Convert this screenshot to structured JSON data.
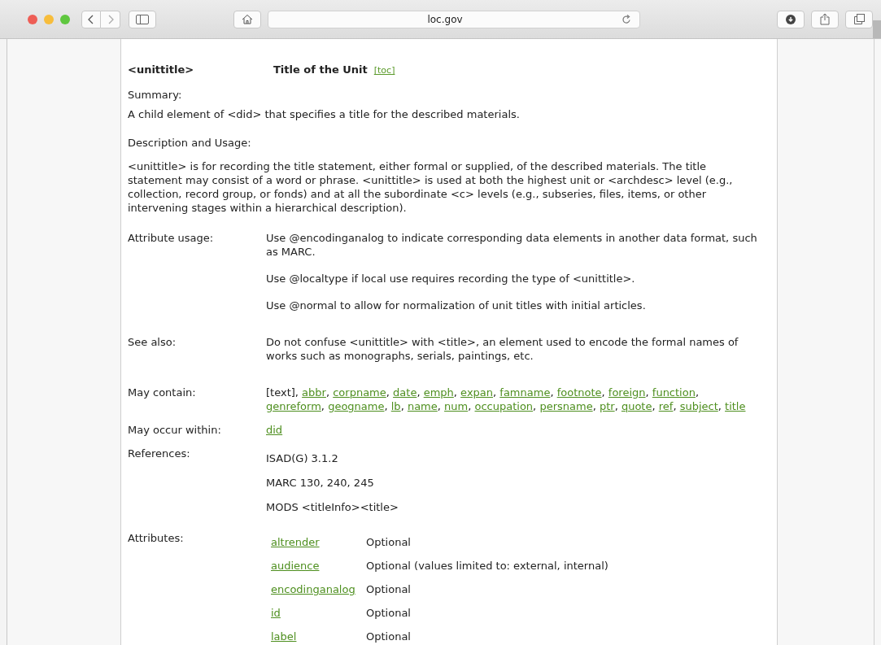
{
  "toolbar": {
    "address": "loc.gov"
  },
  "header": {
    "element": "<unittitle>",
    "title": "Title of the Unit",
    "toc": "[toc]"
  },
  "summary": {
    "label": "Summary:",
    "text": "A child element of <did> that specifies a title for the described materials."
  },
  "description": {
    "label": "Description and Usage:",
    "text": "<unittitle> is for recording the title statement, either formal or supplied, of the described materials. The title statement may consist of a word or phrase. <unittitle> is used at both the highest unit or <archdesc> level (e.g., collection, record group, or fonds) and at all the subordinate <c> levels (e.g., subseries, files, items, or other intervening stages within a hierarchical description)."
  },
  "rows": [
    {
      "kind": "paragraphs",
      "label": "Attribute usage:",
      "paragraphs": [
        "Use @encodinganalog to indicate corresponding data elements in another data format, such as MARC.",
        "Use @localtype if local use requires recording the type of <unittitle>.",
        "Use @normal to allow for normalization of unit titles with initial articles."
      ]
    },
    {
      "kind": "paragraphs",
      "label": "See also:",
      "paragraphs": [
        "Do not confuse <unittitle> with <title>, an element used to encode the formal names of works such as monographs, serials, paintings, etc."
      ]
    },
    {
      "kind": "links",
      "label": "May contain:",
      "separator": ",",
      "items": [
        {
          "text": "[text]",
          "link": false
        },
        {
          "text": "abbr",
          "link": true
        },
        {
          "text": "corpname",
          "link": true
        },
        {
          "text": "date",
          "link": true
        },
        {
          "text": "emph",
          "link": true
        },
        {
          "text": "expan",
          "link": true
        },
        {
          "text": "famname",
          "link": true
        },
        {
          "text": "footnote",
          "link": true
        },
        {
          "text": "foreign",
          "link": true
        },
        {
          "text": "function",
          "link": true
        },
        {
          "text": "genreform",
          "link": true
        },
        {
          "text": "geogname",
          "link": true
        },
        {
          "text": "lb",
          "link": true
        },
        {
          "text": "name",
          "link": true
        },
        {
          "text": "num",
          "link": true
        },
        {
          "text": "occupation",
          "link": true
        },
        {
          "text": "persname",
          "link": true
        },
        {
          "text": "ptr",
          "link": true
        },
        {
          "text": "quote",
          "link": true
        },
        {
          "text": "ref",
          "link": true
        },
        {
          "text": "subject",
          "link": true
        },
        {
          "text": "title",
          "link": true
        }
      ]
    },
    {
      "kind": "links",
      "label": "May occur within:",
      "items": [
        {
          "text": "did",
          "link": true
        }
      ]
    },
    {
      "kind": "references",
      "label": "References:",
      "paragraphs": [
        "ISAD(G) 3.1.2",
        "MARC 130, 240, 245",
        "MODS <titleInfo><title>"
      ]
    },
    {
      "kind": "attributes",
      "label": "Attributes:",
      "attributes": [
        {
          "name": "altrender",
          "usage": "Optional"
        },
        {
          "name": "audience",
          "usage": "Optional (values limited to: external, internal)"
        },
        {
          "name": "encodinganalog",
          "usage": "Optional"
        },
        {
          "name": "id",
          "usage": "Optional"
        },
        {
          "name": "label",
          "usage": "Optional"
        }
      ]
    }
  ]
}
